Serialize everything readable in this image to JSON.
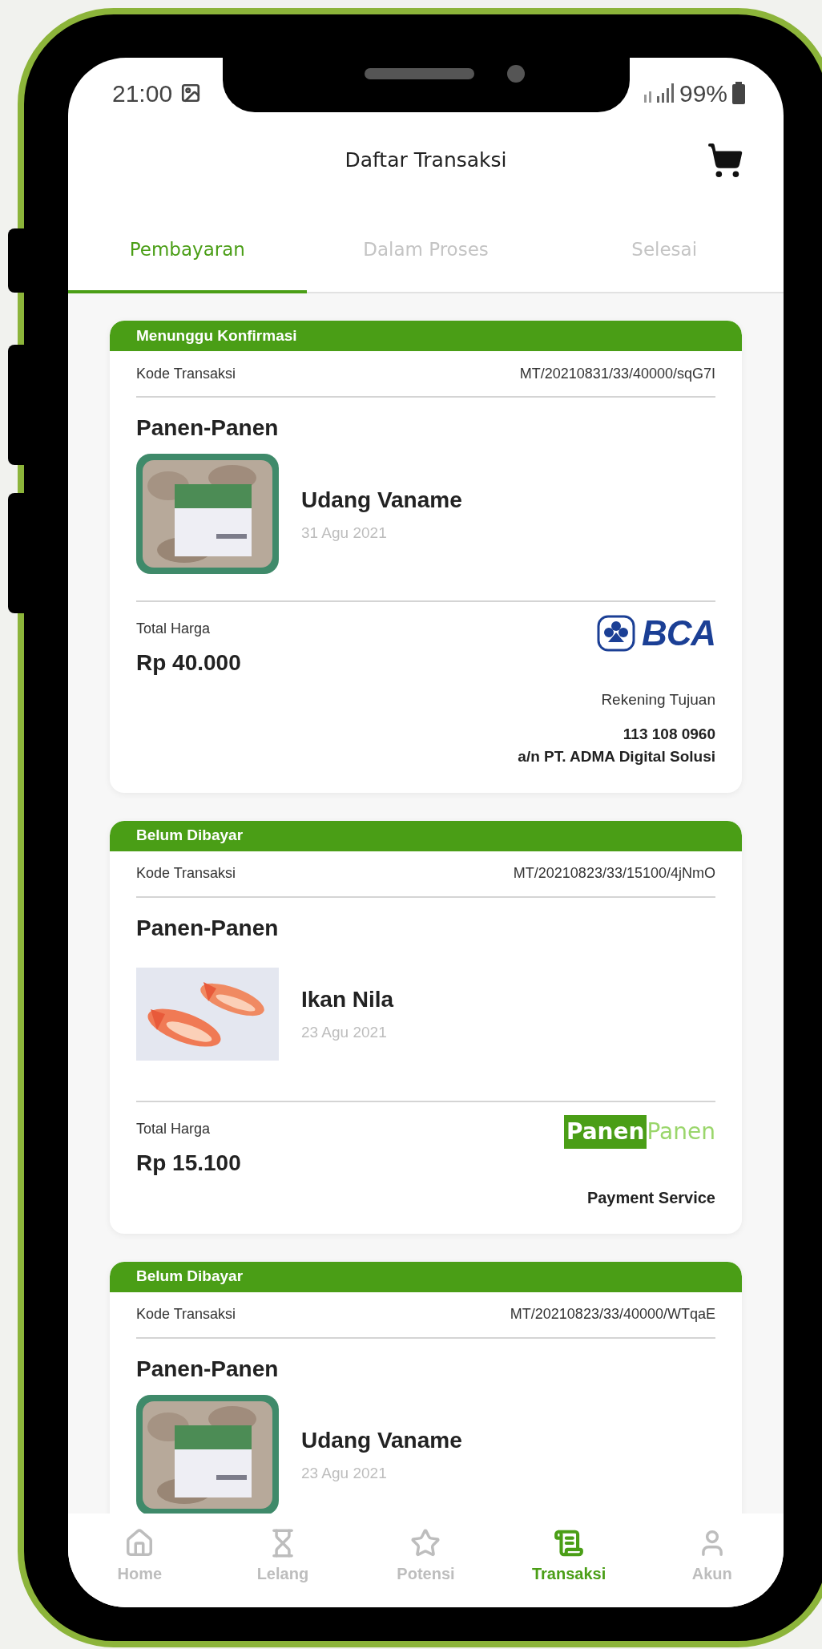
{
  "status_bar": {
    "time": "21:00",
    "battery": "99%"
  },
  "header": {
    "title": "Daftar Transaksi"
  },
  "tabs": [
    {
      "label": "Pembayaran",
      "selected": true
    },
    {
      "label": "Dalam Proses",
      "selected": false
    },
    {
      "label": "Selesai",
      "selected": false
    }
  ],
  "transactions": [
    {
      "status": "Menunggu Konfirmasi",
      "code_label": "Kode Transaksi",
      "code": "MT/20210831/33/40000/sqG7I",
      "store": "Panen-Panen",
      "product": {
        "name": "Udang Vaname",
        "date": "31 Agu 2021"
      },
      "total_label": "Total Harga",
      "total": "Rp 40.000",
      "payment": {
        "kind": "bank",
        "logo_text": "BCA",
        "caption": "Rekening Tujuan",
        "account": "113 108 0960",
        "holder": "a/n PT. ADMA Digital Solusi"
      }
    },
    {
      "status": "Belum Dibayar",
      "code_label": "Kode Transaksi",
      "code": "MT/20210823/33/15100/4jNmO",
      "store": "Panen-Panen",
      "product": {
        "name": "Ikan Nila",
        "date": "23 Agu 2021"
      },
      "total_label": "Total Harga",
      "total": "Rp 15.100",
      "payment": {
        "kind": "service",
        "logo_strong": "Panen",
        "logo_light": "Panen",
        "caption": "Payment Service"
      }
    },
    {
      "status": "Belum Dibayar",
      "code_label": "Kode Transaksi",
      "code": "MT/20210823/33/40000/WTqaE",
      "store": "Panen-Panen",
      "product": {
        "name": "Udang Vaname",
        "date": "23 Agu 2021"
      }
    }
  ],
  "bottom_nav": [
    {
      "label": "Home",
      "selected": false
    },
    {
      "label": "Lelang",
      "selected": false
    },
    {
      "label": "Potensi",
      "selected": false
    },
    {
      "label": "Transaksi",
      "selected": true
    },
    {
      "label": "Akun",
      "selected": false
    }
  ]
}
